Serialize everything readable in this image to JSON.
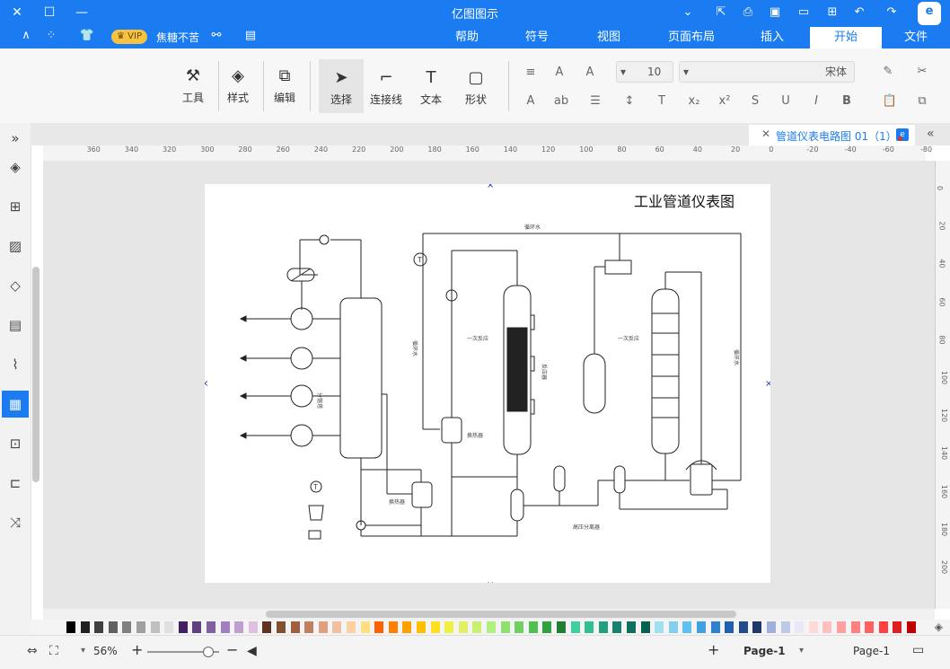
{
  "window": {
    "title": "亿图图示",
    "user_name": "焦糖不苦",
    "vip_label": "VIP"
  },
  "menu_tabs": [
    "文件",
    "开始",
    "插入",
    "页面布局",
    "视图",
    "符号",
    "帮助"
  ],
  "active_menu_tab": "开始",
  "ribbon": {
    "font_name": "宋体",
    "font_size": "10",
    "tools": [
      {
        "label": "形状",
        "icon": "rectangle-icon"
      },
      {
        "label": "文本",
        "icon": "text-icon"
      },
      {
        "label": "连接线",
        "icon": "connector-icon"
      },
      {
        "label": "选择",
        "icon": "pointer-icon"
      },
      {
        "label": "编辑",
        "icon": "edit-icon"
      },
      {
        "label": "样式",
        "icon": "paint-bucket-icon"
      },
      {
        "label": "工具",
        "icon": "tools-icon"
      }
    ]
  },
  "document_tab": {
    "name": "管道仪表电路图 01（1）"
  },
  "ruler_top": [
    "-80",
    "-60",
    "-40",
    "-20",
    "0",
    "20",
    "40",
    "60",
    "80",
    "100",
    "120",
    "140",
    "160",
    "180",
    "200",
    "220",
    "240",
    "260",
    "280",
    "300",
    "320",
    "340",
    "360"
  ],
  "ruler_side": [
    "0",
    "20",
    "40",
    "60",
    "80",
    "100",
    "120",
    "140",
    "160",
    "180",
    "200"
  ],
  "diagram": {
    "title": "工业管道仪表图",
    "labels": {
      "top_pipe": "循环水",
      "left_tower": "分馏塔",
      "reactor_a": "一次反应",
      "reactor_side": "反应器",
      "reactor_b": "一次反应",
      "right_pipe": "循环水",
      "left_pipe": "循环水",
      "heat_exchanger": "换热器",
      "bottom_exchanger": "换热器",
      "separator": "高压分离器",
      "temp_a": "T",
      "temp_b": "T"
    }
  },
  "status": {
    "page_tab": "Page-1",
    "page_selector": "Page-1",
    "zoom": "56%"
  },
  "palette_colors": [
    "#c00000",
    "#e02020",
    "#ff4040",
    "#ff6060",
    "#ff8080",
    "#ffa0a0",
    "#ffc0c0",
    "#ffd8d8",
    "#e8e8f8",
    "#c0c8e8",
    "#a0b0d8",
    "#1f3a6a",
    "#204a8a",
    "#2060b0",
    "#3080d0",
    "#40a0e0",
    "#60c0f0",
    "#80d0f0",
    "#a0e0f0",
    "#0a6050",
    "#107060",
    "#188070",
    "#20a080",
    "#30c090",
    "#40d0a0",
    "#208030",
    "#30a040",
    "#50c050",
    "#70d060",
    "#90e070",
    "#b0f080",
    "#c8f070",
    "#e0f060",
    "#f0f040",
    "#ffe020",
    "#ffc000",
    "#ffa000",
    "#ff8000",
    "#ff6000",
    "#ffe080",
    "#ffd0a0",
    "#f0c0a0",
    "#e0a080",
    "#c08060",
    "#a06040",
    "#805030",
    "#603020",
    "#e0c0e0",
    "#c0a0d0",
    "#a080c0",
    "#8060a0",
    "#604080",
    "#402060",
    "#e0e0e0",
    "#c0c0c0",
    "#a0a0a0",
    "#808080",
    "#606060",
    "#404040",
    "#202020",
    "#000000"
  ]
}
